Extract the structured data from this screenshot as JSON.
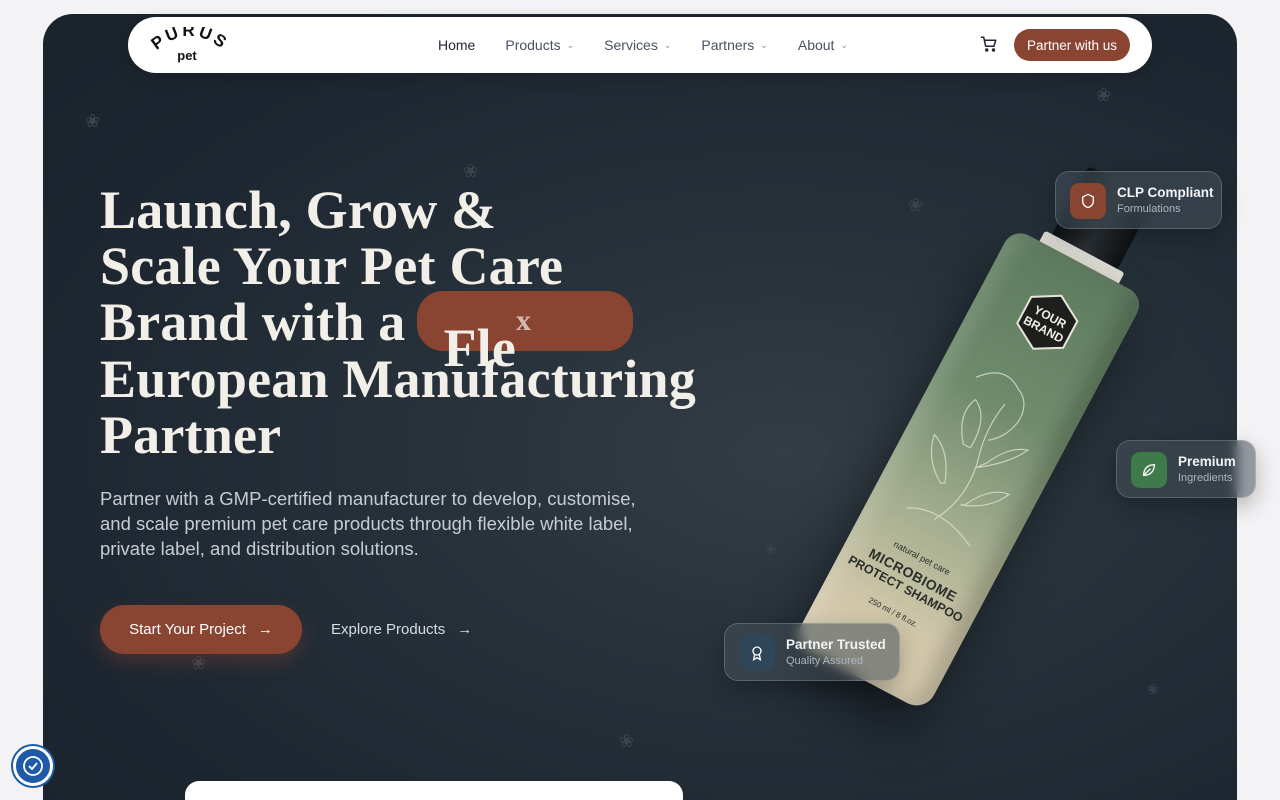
{
  "nav": {
    "logo_top": "PURUS",
    "logo_bottom": "pet",
    "items": [
      {
        "label": "Home",
        "has_dropdown": false
      },
      {
        "label": "Products",
        "has_dropdown": true
      },
      {
        "label": "Services",
        "has_dropdown": true
      },
      {
        "label": "Partners",
        "has_dropdown": true
      },
      {
        "label": "About",
        "has_dropdown": true
      }
    ],
    "cart_icon": "cart-icon",
    "cta_label": "Partner with us"
  },
  "hero": {
    "headline_lines": [
      "Launch, Grow &",
      "Scale Your Pet Care",
      "Brand with a",
      "European Manufacturing",
      "Partner"
    ],
    "pill_text": "Fle",
    "pill_sup": "x",
    "subheadline": "Partner with a GMP-certified manufacturer to develop, customise, and scale premium pet care products through flexible white label, private label, and distribution solutions.",
    "primary_button": "Start Your Project",
    "secondary_button": "Explore Products"
  },
  "product": {
    "brand_top": "YOUR",
    "brand_bottom": "BRAND",
    "tagline": "natural pet care",
    "name_line1": "MICROBIOME",
    "name_line2": "PROTECT SHAMPOO",
    "volume": "250 ml / 8 fl.oz."
  },
  "badges": [
    {
      "title": "CLP Compliant",
      "subtitle": "Formulations",
      "icon": "shield-icon",
      "color": "#8a4432"
    },
    {
      "title": "Premium",
      "subtitle": "Ingredients",
      "icon": "leaf-icon",
      "color": "#3f7a4a"
    },
    {
      "title": "Partner Trusted",
      "subtitle": "Quality Assured",
      "icon": "award-icon",
      "color": "#2e4657"
    }
  ],
  "colors": {
    "accent": "#8a4432",
    "hero_bg": "#1f2831",
    "headline": "#f2eee8"
  }
}
